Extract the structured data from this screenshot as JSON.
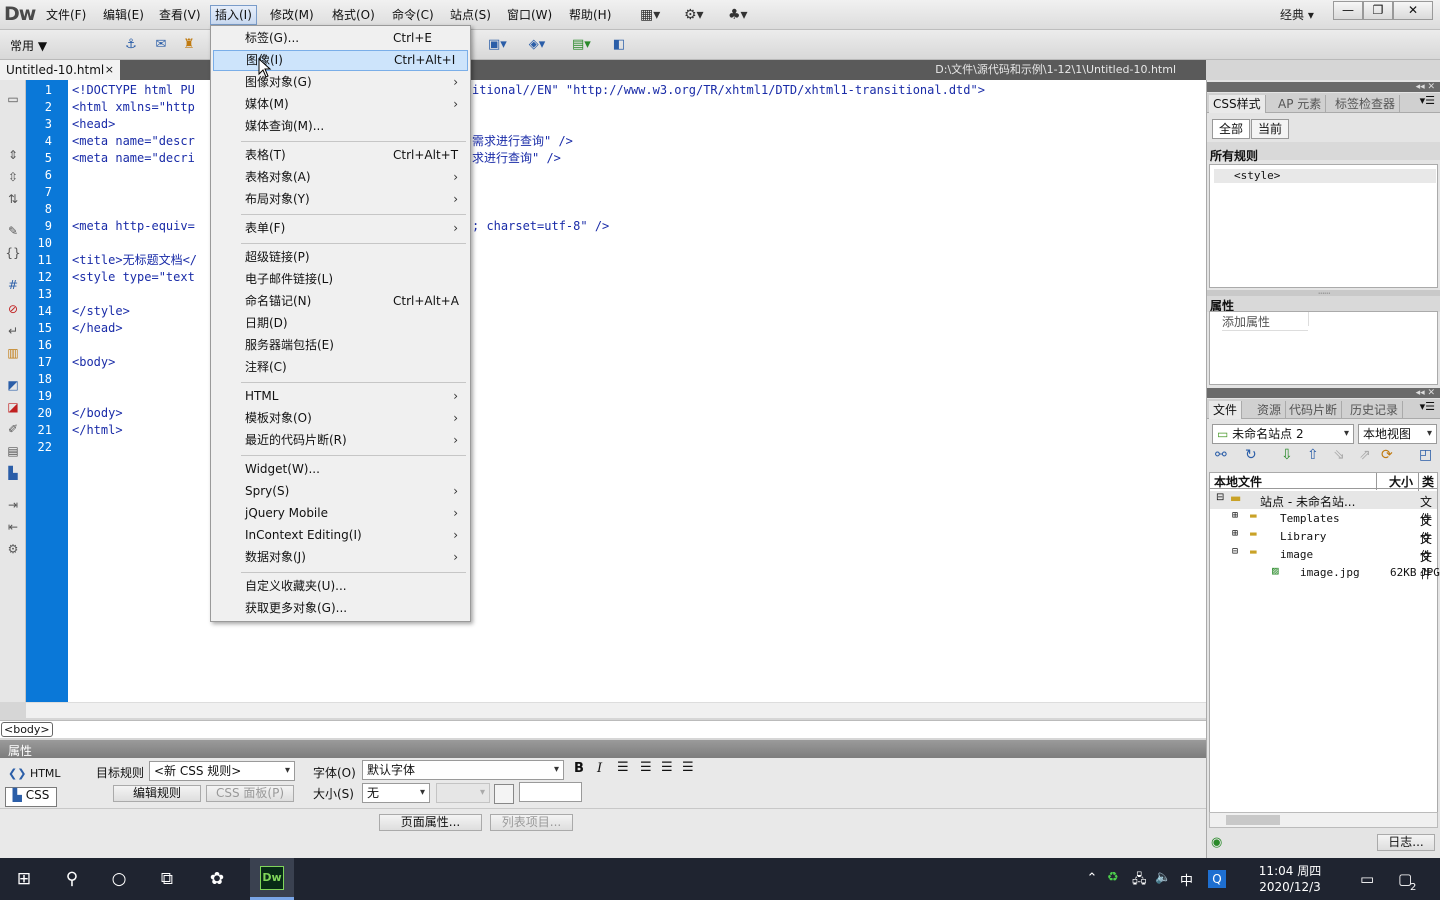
{
  "app": {
    "logo": "Dw",
    "workspace": "经典",
    "menus": [
      "文件(F)",
      "编辑(E)",
      "查看(V)",
      "插入(I)",
      "修改(M)",
      "格式(O)",
      "命令(C)",
      "站点(S)",
      "窗口(W)",
      "帮助(H)"
    ],
    "window_buttons": [
      "—",
      "❐",
      "✕"
    ]
  },
  "toolbar": {
    "insert_category": "常用"
  },
  "doc": {
    "tab_label": "Untitled-10.html",
    "tab_close": "×",
    "file_path": "D:\\文件\\源代码和示例\\1-12\\1\\Untitled-10.html",
    "line_numbers": [
      "1",
      "2",
      "3",
      "4",
      "5",
      "6",
      "7",
      "8",
      "9",
      "10",
      "11",
      "12",
      "13",
      "14",
      "15",
      "16",
      "17",
      "18",
      "19",
      "20",
      "21",
      "22"
    ],
    "code_left": [
      "<!DOCTYPE html PU",
      "<html xmlns=\"http",
      "<head>",
      "<meta name=\"descr",
      "<meta name=\"decri",
      "",
      "",
      "",
      "<meta http-equiv=",
      "",
      "<title>无标题文档</",
      "<style type=\"text",
      "",
      "</style>",
      "</head>",
      "",
      "<body>",
      "",
      "",
      "</body>",
      "</html>",
      ""
    ],
    "code_right": [
      "itional//EN\" \"http://www.w3.org/TR/xhtml1/DTD/xhtml1-transitional.dtd\">",
      "",
      "",
      "需求进行查询\" />",
      "求进行查询\" />",
      "",
      "",
      "",
      "; charset=utf-8\" />",
      "",
      "",
      "",
      "",
      "",
      "",
      "",
      "",
      "",
      "",
      "",
      "",
      ""
    ],
    "tag_selector": "<body>"
  },
  "insert_menu": {
    "items": [
      {
        "label": "标签(G)...",
        "shortcut": "Ctrl+E",
        "submenu": false
      },
      {
        "label": "图像(I)",
        "shortcut": "Ctrl+Alt+I",
        "submenu": false,
        "highlighted": true
      },
      {
        "label": "图像对象(G)",
        "shortcut": "",
        "submenu": true
      },
      {
        "label": "媒体(M)",
        "shortcut": "",
        "submenu": true
      },
      {
        "label": "媒体查询(M)...",
        "shortcut": "",
        "submenu": false
      },
      {
        "label": "表格(T)",
        "shortcut": "Ctrl+Alt+T",
        "submenu": false
      },
      {
        "label": "表格对象(A)",
        "shortcut": "",
        "submenu": true
      },
      {
        "label": "布局对象(Y)",
        "shortcut": "",
        "submenu": true
      },
      {
        "label": "表单(F)",
        "shortcut": "",
        "submenu": true
      },
      {
        "label": "超级链接(P)",
        "shortcut": "",
        "submenu": false
      },
      {
        "label": "电子邮件链接(L)",
        "shortcut": "",
        "submenu": false
      },
      {
        "label": "命名锚记(N)",
        "shortcut": "Ctrl+Alt+A",
        "submenu": false
      },
      {
        "label": "日期(D)",
        "shortcut": "",
        "submenu": false
      },
      {
        "label": "服务器端包括(E)",
        "shortcut": "",
        "submenu": false
      },
      {
        "label": "注释(C)",
        "shortcut": "",
        "submenu": false
      },
      {
        "label": "HTML",
        "shortcut": "",
        "submenu": true
      },
      {
        "label": "模板对象(O)",
        "shortcut": "",
        "submenu": true
      },
      {
        "label": "最近的代码片断(R)",
        "shortcut": "",
        "submenu": true
      },
      {
        "label": "Widget(W)...",
        "shortcut": "",
        "submenu": false
      },
      {
        "label": "Spry(S)",
        "shortcut": "",
        "submenu": true
      },
      {
        "label": "jQuery Mobile",
        "shortcut": "",
        "submenu": true
      },
      {
        "label": "InContext Editing(I)",
        "shortcut": "",
        "submenu": true
      },
      {
        "label": "数据对象(J)",
        "shortcut": "",
        "submenu": true
      },
      {
        "label": "自定义收藏夹(U)...",
        "shortcut": "",
        "submenu": false
      },
      {
        "label": "获取更多对象(G)...",
        "shortcut": "",
        "submenu": false
      }
    ]
  },
  "properties": {
    "title": "属性",
    "html_btn": "HTML",
    "css_btn": "CSS",
    "target_rule_label": "目标规则",
    "target_rule_value": "<新 CSS 规则>",
    "edit_rule_btn": "编辑规则",
    "css_panel_btn": "CSS 面板(P)",
    "font_label": "字体(O)",
    "font_value": "默认字体",
    "size_label": "大小(S)",
    "size_value": "无",
    "bold": "B",
    "italic": "I",
    "page_props_btn": "页面属性...",
    "list_item_btn": "列表项目..."
  },
  "css_panel": {
    "tabs": [
      "CSS样式",
      "AP 元素",
      "标签检查器"
    ],
    "mode_all": "全部",
    "mode_current": "当前",
    "all_rules_label": "所有规则",
    "rule_item": "<style>",
    "attributes_label": "属性",
    "add_attribute": "添加属性"
  },
  "files_panel": {
    "tabs": [
      "文件",
      "资源",
      "代码片断",
      "历史记录"
    ],
    "site_select": "未命名站点 2",
    "view_select": "本地视图",
    "col_local": "本地文件",
    "col_size": "大小",
    "col_type": "类型",
    "rows": [
      {
        "name": "站点 - 未命名站...",
        "size": "",
        "type": "文件"
      },
      {
        "name": "Templates",
        "size": "",
        "type": "文件"
      },
      {
        "name": "Library",
        "size": "",
        "type": "文件"
      },
      {
        "name": "image",
        "size": "",
        "type": "文件"
      },
      {
        "name": "image.jpg",
        "size": "62KB",
        "type": "JPG"
      }
    ],
    "log_btn": "日志..."
  },
  "taskbar": {
    "time": "11:04 周四",
    "date": "2020/12/3",
    "ime": "中",
    "notification_count": "2"
  }
}
